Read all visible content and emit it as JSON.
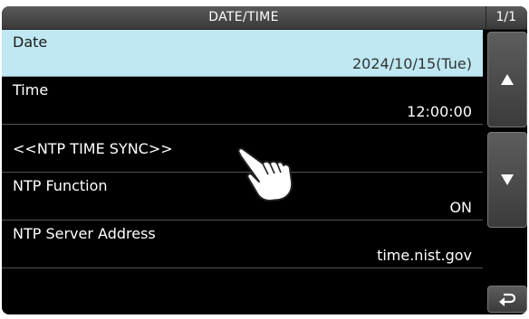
{
  "header": {
    "title": "DATE/TIME",
    "page_indicator": "1/1"
  },
  "rows": [
    {
      "label": "Date",
      "value": "2024/10/15(Tue)",
      "selected": true
    },
    {
      "label": "Time",
      "value": "12:00:00"
    },
    {
      "label": "<<NTP TIME SYNC>>",
      "value": ""
    },
    {
      "label": "NTP Function",
      "value": "ON"
    },
    {
      "label": "NTP Server Address",
      "value": "time.nist.gov"
    }
  ],
  "sidebar": {
    "up_icon": "up-triangle-icon",
    "down_icon": "down-triangle-icon",
    "back_icon": "return-arrow-icon"
  },
  "colors": {
    "selected_row": "#bfe8f2",
    "background": "#000000",
    "text": "#ffffff"
  },
  "pointer_icon": "pointing-hand-icon"
}
